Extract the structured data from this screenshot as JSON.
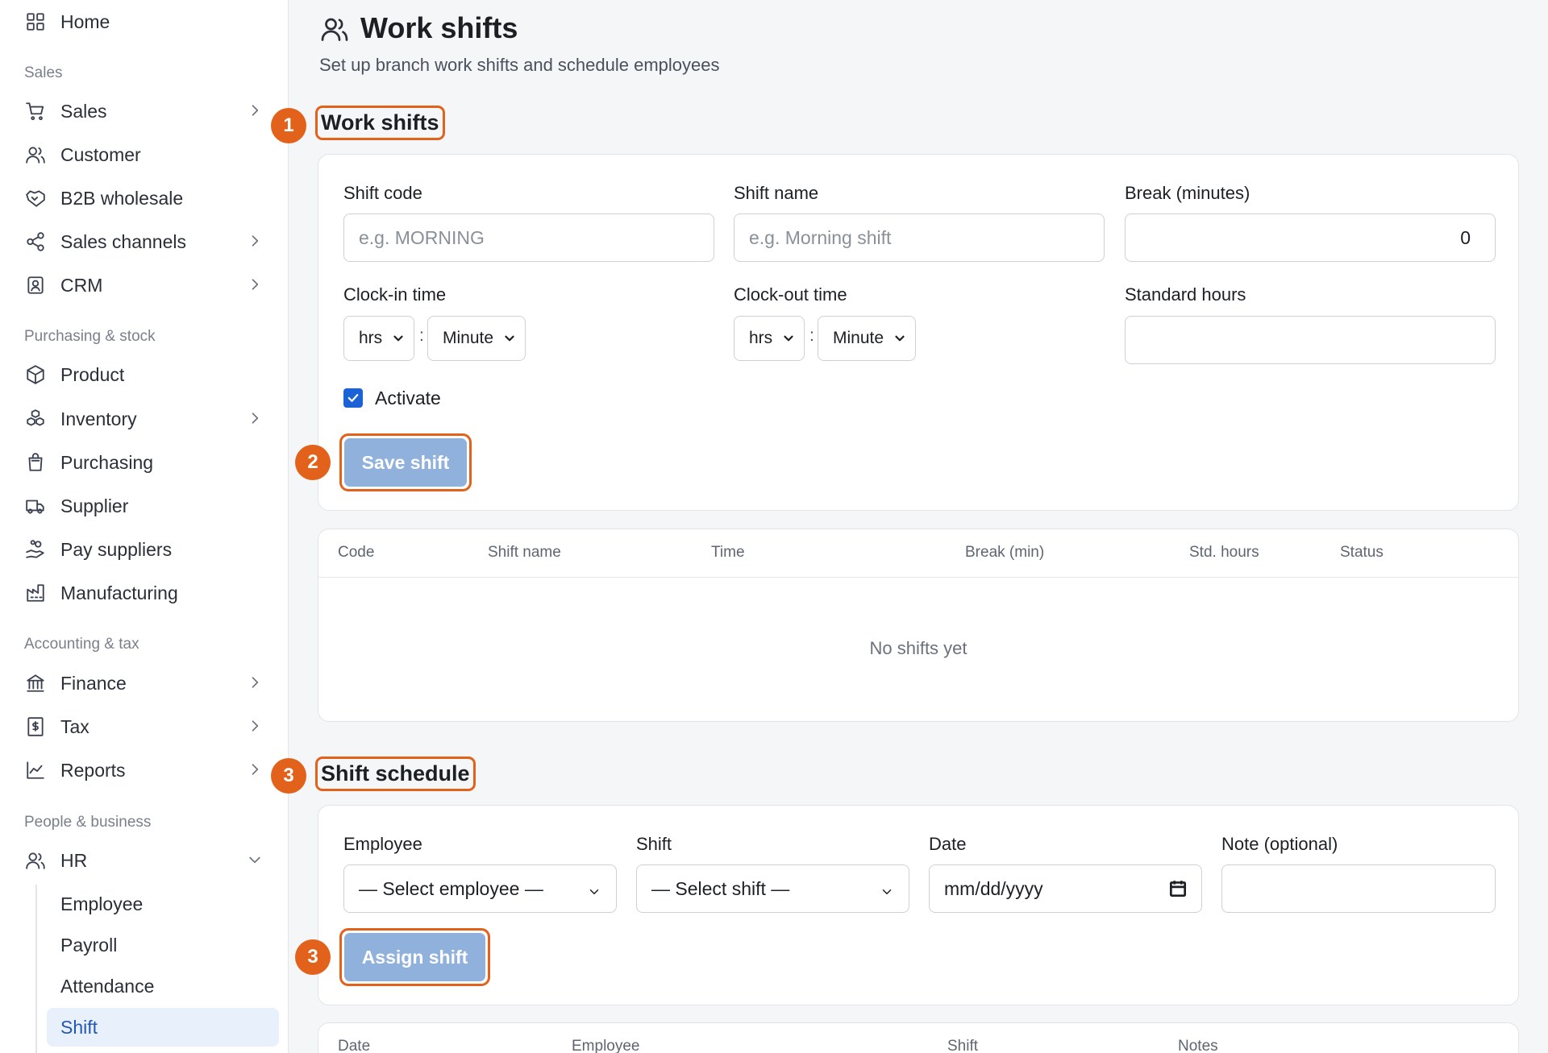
{
  "sidebar": {
    "home": "Home",
    "sections": {
      "sales": "Sales",
      "purchasing": "Purchasing & stock",
      "accounting": "Accounting & tax",
      "people": "People & business"
    },
    "items": {
      "sales": "Sales",
      "customer": "Customer",
      "b2b": "B2B wholesale",
      "channels": "Sales channels",
      "crm": "CRM",
      "product": "Product",
      "inventory": "Inventory",
      "purchasing": "Purchasing",
      "supplier": "Supplier",
      "pay_suppliers": "Pay suppliers",
      "manufacturing": "Manufacturing",
      "finance": "Finance",
      "tax": "Tax",
      "reports": "Reports",
      "hr": "HR"
    },
    "hr_sub": {
      "employee": "Employee",
      "payroll": "Payroll",
      "attendance": "Attendance",
      "shift": "Shift"
    }
  },
  "header": {
    "title": "Work shifts",
    "subtitle": "Set up branch work shifts and schedule employees"
  },
  "work_shifts": {
    "section_title": "Work shifts",
    "badge": "1",
    "shift_code_label": "Shift code",
    "shift_code_placeholder": "e.g. MORNING",
    "shift_name_label": "Shift name",
    "shift_name_placeholder": "e.g. Morning shift",
    "break_label": "Break (minutes)",
    "break_value": "0",
    "clock_in_label": "Clock-in time",
    "clock_out_label": "Clock-out time",
    "hrs": "hrs",
    "minute": "Minute",
    "colon": ":",
    "std_hours_label": "Standard hours",
    "activate_label": "Activate",
    "save_badge": "2",
    "save_button": "Save shift"
  },
  "shifts_table": {
    "columns": [
      "Code",
      "Shift name",
      "Time",
      "Break (min)",
      "Std. hours",
      "Status"
    ],
    "empty": "No shifts yet"
  },
  "schedule": {
    "section_title": "Shift schedule",
    "badge": "3",
    "employee_label": "Employee",
    "employee_value": "— Select employee —",
    "shift_label": "Shift",
    "shift_value": "— Select shift —",
    "date_label": "Date",
    "date_value": "mm/dd/yyyy",
    "note_label": "Note (optional)",
    "assign_badge": "3",
    "assign_button": "Assign shift"
  },
  "schedule_table": {
    "columns": [
      "Date",
      "Employee",
      "Shift",
      "Notes"
    ]
  },
  "colors": {
    "accent_orange": "#e2621b",
    "button_blue": "#8fb1dc",
    "checkbox_blue": "#1a62d6",
    "active_nav_bg": "#e8f0fb"
  }
}
